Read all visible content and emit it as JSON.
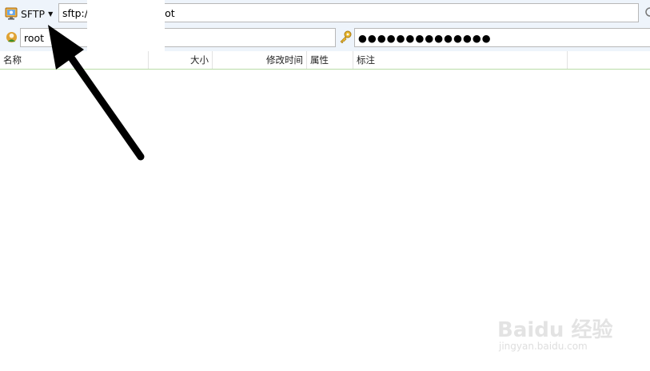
{
  "connection": {
    "protocol": "SFTP",
    "url": "sftp:/                    /root",
    "username": "root",
    "password_mask": "●●●●●●●●●●●●●●"
  },
  "columns": [
    "名称",
    "大小",
    "修改时间",
    "属性",
    "标注"
  ],
  "icons": {
    "protocol": "sftp-computer-icon",
    "dropdown": "caret-down-icon",
    "refresh": "refresh-icon",
    "user": "user-icon",
    "password": "key-icon"
  },
  "watermark": {
    "logo": "Baidu 经验",
    "url": "jingyan.baidu.com"
  },
  "colors": {
    "toolbar_bg": "#eef4fb",
    "header_underline": "#b9dca6",
    "arrow": "#000000"
  }
}
